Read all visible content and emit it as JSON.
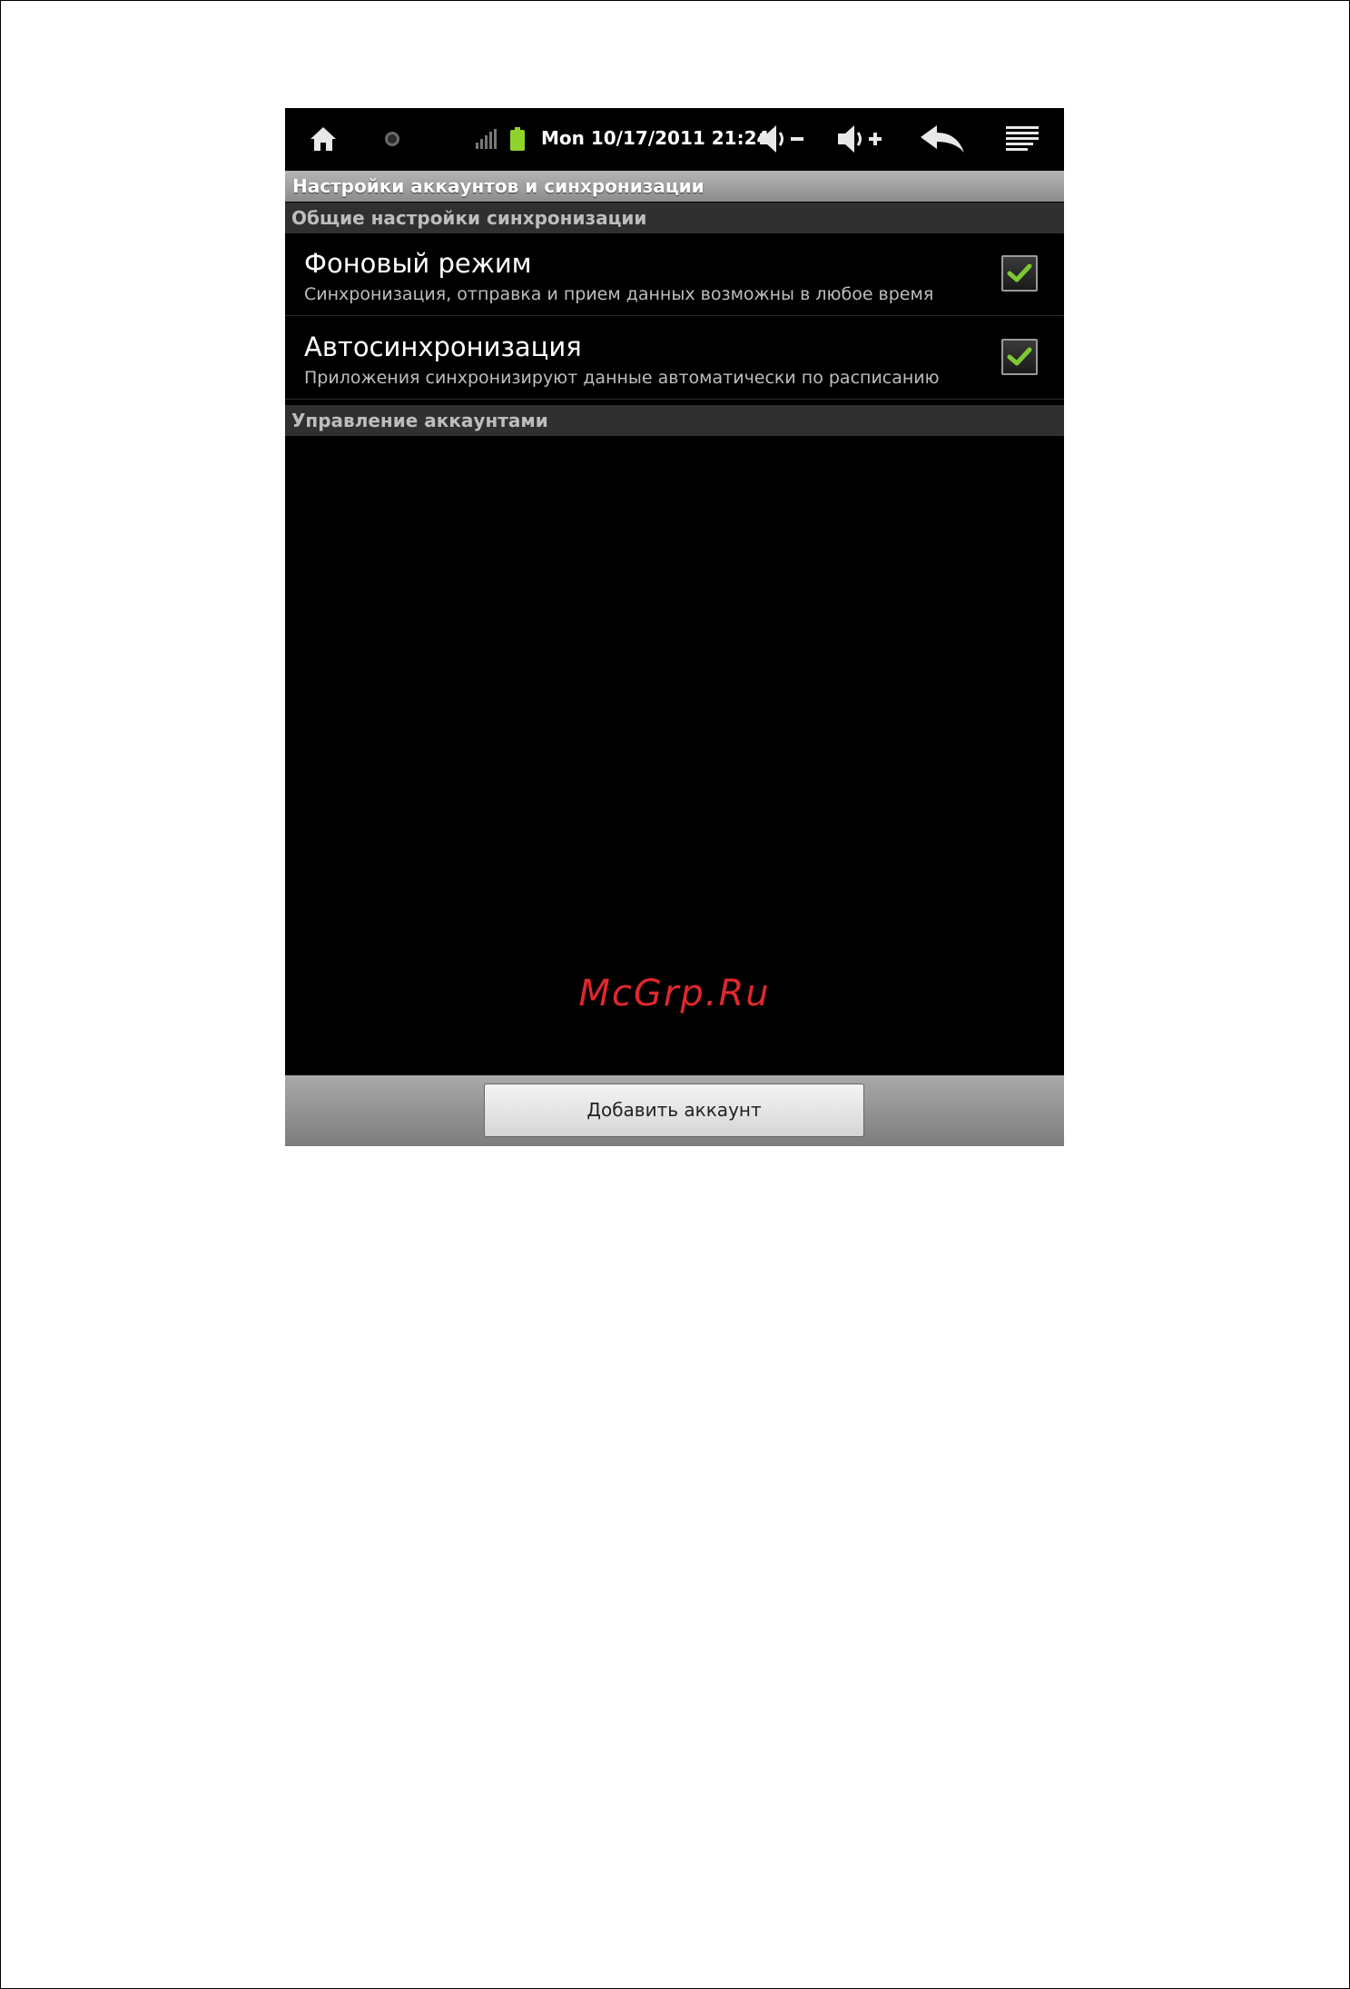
{
  "status_bar": {
    "datetime": "Mon 10/17/2011 21:24",
    "icons": [
      "home-icon",
      "notification-dot-icon",
      "signal-icon",
      "battery-icon",
      "volume-down-icon",
      "volume-up-icon",
      "back-icon",
      "menu-icon"
    ]
  },
  "title": "Настройки аккаунтов и синхронизации",
  "sections": {
    "general": "Общие настройки синхронизации",
    "accounts": "Управление аккаунтами"
  },
  "prefs": [
    {
      "title": "Фоновый режим",
      "summary": "Синхронизация, отправка и прием данных возможны в любое время",
      "checked": true
    },
    {
      "title": "Автосинхронизация",
      "summary": "Приложения синхронизируют данные автоматически по расписанию",
      "checked": true
    }
  ],
  "watermark": "McGrp.Ru",
  "buttons": {
    "add_account": "Добавить аккаунт"
  },
  "colors": {
    "check_green": "#7ec832",
    "watermark_red": "#e0272e",
    "battery_green": "#8fd42b"
  }
}
